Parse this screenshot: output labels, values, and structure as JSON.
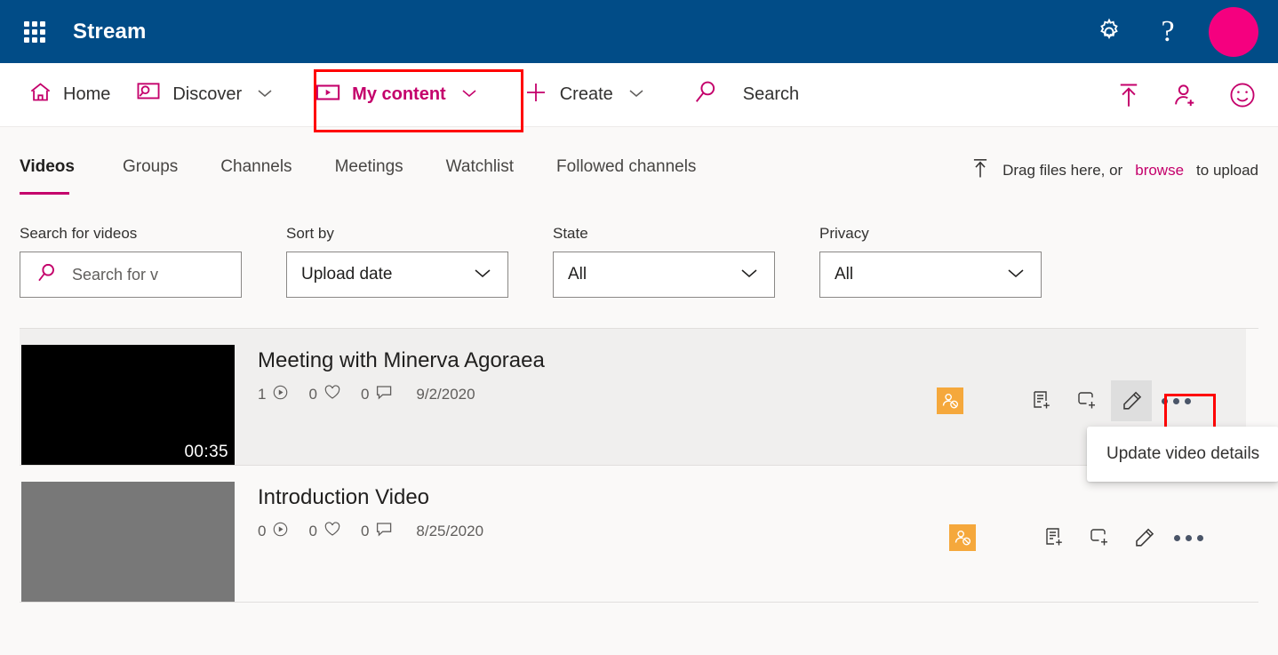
{
  "suite": {
    "title": "Stream",
    "waffle_icon": "app-launcher-waffle-icon",
    "settings_icon": "gear-icon",
    "help_icon": "question-mark-icon",
    "avatar_icon": "user-avatar",
    "bar_color": "#014C87",
    "accent_color": "#C4006B",
    "avatar_color": "#F5007F"
  },
  "nav": {
    "items": [
      {
        "label": "Home",
        "icon": "home-icon",
        "has_chevron": false,
        "active": false
      },
      {
        "label": "Discover",
        "icon": "discover-screen-search-icon",
        "has_chevron": true,
        "active": false
      },
      {
        "label": "My content",
        "icon": "video-play-box-icon",
        "has_chevron": true,
        "active": true
      },
      {
        "label": "Create",
        "icon": "plus-icon",
        "has_chevron": true,
        "active": false
      }
    ],
    "search_label": "Search",
    "search_icon": "search-magnifier-icon",
    "right_icons": [
      {
        "name": "upload-icon"
      },
      {
        "name": "add-person-icon"
      },
      {
        "name": "smiley-feedback-icon"
      }
    ]
  },
  "tabs": [
    {
      "label": "Videos",
      "active": true
    },
    {
      "label": "Groups",
      "active": false
    },
    {
      "label": "Channels",
      "active": false
    },
    {
      "label": "Meetings",
      "active": false
    },
    {
      "label": "Watchlist",
      "active": false
    },
    {
      "label": "Followed channels",
      "active": false
    }
  ],
  "upload": {
    "icon": "upload-arrow-icon",
    "text_before": "Drag files here, or",
    "browse_label": "browse",
    "text_after": "to upload"
  },
  "filters": {
    "search": {
      "label": "Search for videos",
      "placeholder": "Search for v",
      "value": "",
      "icon": "search-magnifier-icon"
    },
    "sort": {
      "label": "Sort by",
      "value": "Upload date"
    },
    "state": {
      "label": "State",
      "value": "All"
    },
    "privacy": {
      "label": "Privacy",
      "value": "All"
    }
  },
  "videos": [
    {
      "title": "Meeting with Minerva Agoraea",
      "views": "1",
      "likes": "0",
      "comments": "0",
      "date": "9/2/2020",
      "duration": "00:35",
      "thumb_style": "dark",
      "privacy_badge": "private-person-restricted-icon",
      "hovered": true
    },
    {
      "title": "Introduction Video",
      "views": "0",
      "likes": "0",
      "comments": "0",
      "date": "8/25/2020",
      "duration": "",
      "thumb_style": "gray",
      "privacy_badge": "private-person-restricted-icon",
      "hovered": false
    }
  ],
  "row_actions": [
    {
      "name": "add-to-watchlist-icon"
    },
    {
      "name": "add-to-group-icon"
    },
    {
      "name": "edit-pencil-icon"
    },
    {
      "name": "more-options-icon"
    }
  ],
  "tooltip": {
    "text": "Update video details"
  },
  "annotations": {
    "highlight_color": "#FF0000",
    "boxes": [
      "my-content-nav-highlight",
      "edit-pencil-highlight"
    ]
  }
}
